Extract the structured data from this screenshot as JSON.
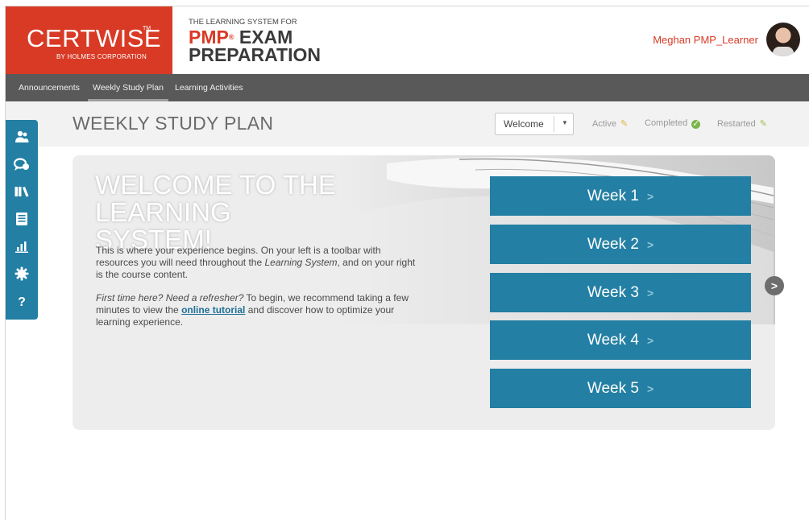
{
  "brand": {
    "logo": "CERTWISE",
    "tm": "TM",
    "logo_sub": "BY HOLMES CORPORATION",
    "tagline": "THE LEARNING SYSTEM FOR",
    "pmp": "PMP",
    "reg": "®",
    "exam": "EXAM",
    "prep": "PREPARATION"
  },
  "user": {
    "name": "Meghan PMP_Learner"
  },
  "nav": {
    "items": [
      {
        "label": "Announcements"
      },
      {
        "label": "Weekly Study Plan"
      },
      {
        "label": "Learning Activities"
      }
    ]
  },
  "page": {
    "title": "WEEKLY STUDY PLAN"
  },
  "week_select": {
    "value": "Welcome"
  },
  "legend": {
    "active": "Active",
    "completed": "Completed",
    "restarted": "Restarted"
  },
  "toolbar": {
    "icons": [
      "people-icon",
      "chat-icon",
      "books-icon",
      "notes-icon",
      "chart-icon",
      "gear-icon",
      "help-icon"
    ]
  },
  "welcome": {
    "heading_line1": "WELCOME TO THE",
    "heading_line2": "LEARNING SYSTEM!",
    "p1_a": "This is where your experience begins. On your left is a toolbar with resources you will need throughout the ",
    "p1_em": "Learning System",
    "p1_b": ", and on your right is the course content.",
    "p2_em": "First time here? Need a refresher?",
    "p2_a": " To begin, we recommend taking a few minutes to view the ",
    "p2_link": "online tutorial",
    "p2_b": " and discover how to optimize your learning experience."
  },
  "weeks": [
    {
      "label": "Week 1"
    },
    {
      "label": "Week 2"
    },
    {
      "label": "Week 3"
    },
    {
      "label": "Week 4"
    },
    {
      "label": "Week 5"
    }
  ],
  "colors": {
    "brand_red": "#d93a25",
    "accent_blue": "#237fa3",
    "nav_gray": "#595959"
  }
}
